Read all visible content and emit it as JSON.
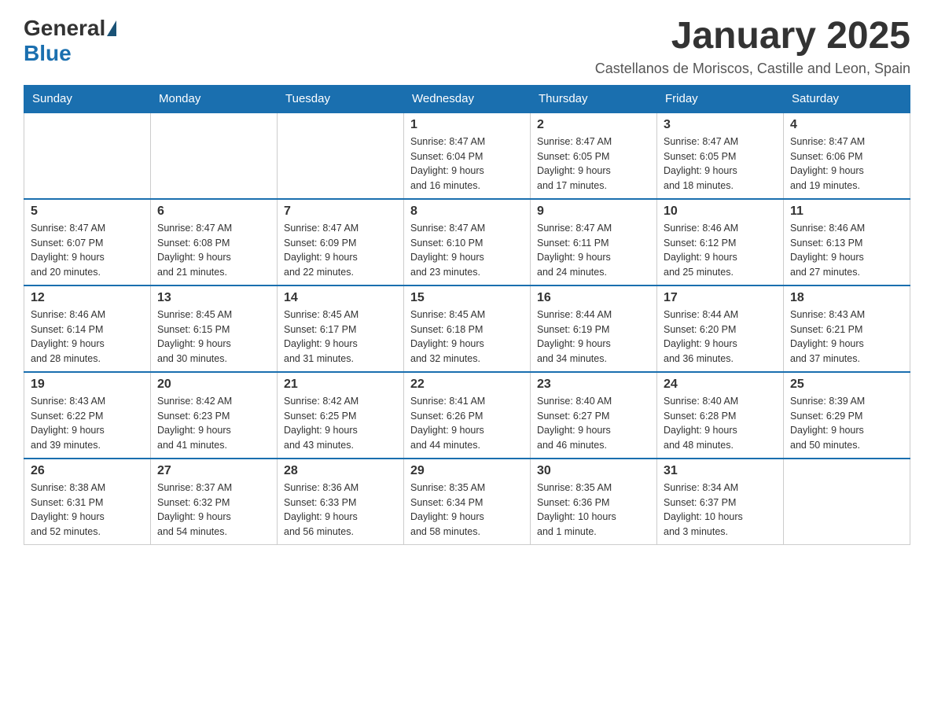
{
  "header": {
    "logo": {
      "general": "General",
      "blue": "Blue"
    },
    "title": "January 2025",
    "subtitle": "Castellanos de Moriscos, Castille and Leon, Spain"
  },
  "days": [
    "Sunday",
    "Monday",
    "Tuesday",
    "Wednesday",
    "Thursday",
    "Friday",
    "Saturday"
  ],
  "weeks": [
    [
      {
        "day": "",
        "info": ""
      },
      {
        "day": "",
        "info": ""
      },
      {
        "day": "",
        "info": ""
      },
      {
        "day": "1",
        "info": "Sunrise: 8:47 AM\nSunset: 6:04 PM\nDaylight: 9 hours\nand 16 minutes."
      },
      {
        "day": "2",
        "info": "Sunrise: 8:47 AM\nSunset: 6:05 PM\nDaylight: 9 hours\nand 17 minutes."
      },
      {
        "day": "3",
        "info": "Sunrise: 8:47 AM\nSunset: 6:05 PM\nDaylight: 9 hours\nand 18 minutes."
      },
      {
        "day": "4",
        "info": "Sunrise: 8:47 AM\nSunset: 6:06 PM\nDaylight: 9 hours\nand 19 minutes."
      }
    ],
    [
      {
        "day": "5",
        "info": "Sunrise: 8:47 AM\nSunset: 6:07 PM\nDaylight: 9 hours\nand 20 minutes."
      },
      {
        "day": "6",
        "info": "Sunrise: 8:47 AM\nSunset: 6:08 PM\nDaylight: 9 hours\nand 21 minutes."
      },
      {
        "day": "7",
        "info": "Sunrise: 8:47 AM\nSunset: 6:09 PM\nDaylight: 9 hours\nand 22 minutes."
      },
      {
        "day": "8",
        "info": "Sunrise: 8:47 AM\nSunset: 6:10 PM\nDaylight: 9 hours\nand 23 minutes."
      },
      {
        "day": "9",
        "info": "Sunrise: 8:47 AM\nSunset: 6:11 PM\nDaylight: 9 hours\nand 24 minutes."
      },
      {
        "day": "10",
        "info": "Sunrise: 8:46 AM\nSunset: 6:12 PM\nDaylight: 9 hours\nand 25 minutes."
      },
      {
        "day": "11",
        "info": "Sunrise: 8:46 AM\nSunset: 6:13 PM\nDaylight: 9 hours\nand 27 minutes."
      }
    ],
    [
      {
        "day": "12",
        "info": "Sunrise: 8:46 AM\nSunset: 6:14 PM\nDaylight: 9 hours\nand 28 minutes."
      },
      {
        "day": "13",
        "info": "Sunrise: 8:45 AM\nSunset: 6:15 PM\nDaylight: 9 hours\nand 30 minutes."
      },
      {
        "day": "14",
        "info": "Sunrise: 8:45 AM\nSunset: 6:17 PM\nDaylight: 9 hours\nand 31 minutes."
      },
      {
        "day": "15",
        "info": "Sunrise: 8:45 AM\nSunset: 6:18 PM\nDaylight: 9 hours\nand 32 minutes."
      },
      {
        "day": "16",
        "info": "Sunrise: 8:44 AM\nSunset: 6:19 PM\nDaylight: 9 hours\nand 34 minutes."
      },
      {
        "day": "17",
        "info": "Sunrise: 8:44 AM\nSunset: 6:20 PM\nDaylight: 9 hours\nand 36 minutes."
      },
      {
        "day": "18",
        "info": "Sunrise: 8:43 AM\nSunset: 6:21 PM\nDaylight: 9 hours\nand 37 minutes."
      }
    ],
    [
      {
        "day": "19",
        "info": "Sunrise: 8:43 AM\nSunset: 6:22 PM\nDaylight: 9 hours\nand 39 minutes."
      },
      {
        "day": "20",
        "info": "Sunrise: 8:42 AM\nSunset: 6:23 PM\nDaylight: 9 hours\nand 41 minutes."
      },
      {
        "day": "21",
        "info": "Sunrise: 8:42 AM\nSunset: 6:25 PM\nDaylight: 9 hours\nand 43 minutes."
      },
      {
        "day": "22",
        "info": "Sunrise: 8:41 AM\nSunset: 6:26 PM\nDaylight: 9 hours\nand 44 minutes."
      },
      {
        "day": "23",
        "info": "Sunrise: 8:40 AM\nSunset: 6:27 PM\nDaylight: 9 hours\nand 46 minutes."
      },
      {
        "day": "24",
        "info": "Sunrise: 8:40 AM\nSunset: 6:28 PM\nDaylight: 9 hours\nand 48 minutes."
      },
      {
        "day": "25",
        "info": "Sunrise: 8:39 AM\nSunset: 6:29 PM\nDaylight: 9 hours\nand 50 minutes."
      }
    ],
    [
      {
        "day": "26",
        "info": "Sunrise: 8:38 AM\nSunset: 6:31 PM\nDaylight: 9 hours\nand 52 minutes."
      },
      {
        "day": "27",
        "info": "Sunrise: 8:37 AM\nSunset: 6:32 PM\nDaylight: 9 hours\nand 54 minutes."
      },
      {
        "day": "28",
        "info": "Sunrise: 8:36 AM\nSunset: 6:33 PM\nDaylight: 9 hours\nand 56 minutes."
      },
      {
        "day": "29",
        "info": "Sunrise: 8:35 AM\nSunset: 6:34 PM\nDaylight: 9 hours\nand 58 minutes."
      },
      {
        "day": "30",
        "info": "Sunrise: 8:35 AM\nSunset: 6:36 PM\nDaylight: 10 hours\nand 1 minute."
      },
      {
        "day": "31",
        "info": "Sunrise: 8:34 AM\nSunset: 6:37 PM\nDaylight: 10 hours\nand 3 minutes."
      },
      {
        "day": "",
        "info": ""
      }
    ]
  ]
}
